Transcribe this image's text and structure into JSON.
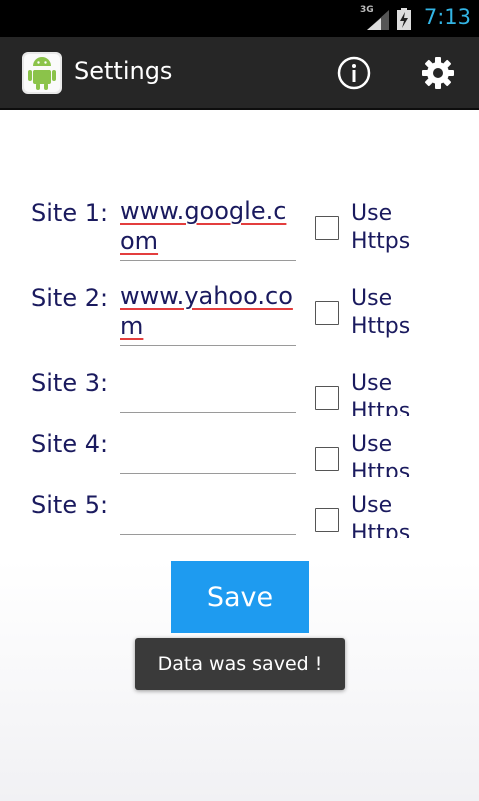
{
  "status_bar": {
    "network": "3G",
    "time": "7:13",
    "time_color": "#33b5e5"
  },
  "action_bar": {
    "title": "Settings",
    "app_icon": "android-robot-icon",
    "info_icon": "info-icon",
    "settings_icon": "gear-icon"
  },
  "form": {
    "rows": [
      {
        "label": "Site 1:",
        "value": "www.google.com",
        "checkbox_label": "Use Https",
        "checked": false
      },
      {
        "label": "Site 2:",
        "value": "www.yahoo.com",
        "checkbox_label": "Use Https",
        "checked": false
      },
      {
        "label": "Site 3:",
        "value": "",
        "checkbox_label": "Use Https",
        "checked": false
      },
      {
        "label": "Site 4:",
        "value": "",
        "checkbox_label": "Use Https",
        "checked": false
      },
      {
        "label": "Site 5:",
        "value": "",
        "checkbox_label": "Use Https",
        "checked": false
      }
    ]
  },
  "save_button": {
    "label": "Save",
    "color": "#1e9bf0"
  },
  "toast": {
    "message": "Data was saved !"
  }
}
